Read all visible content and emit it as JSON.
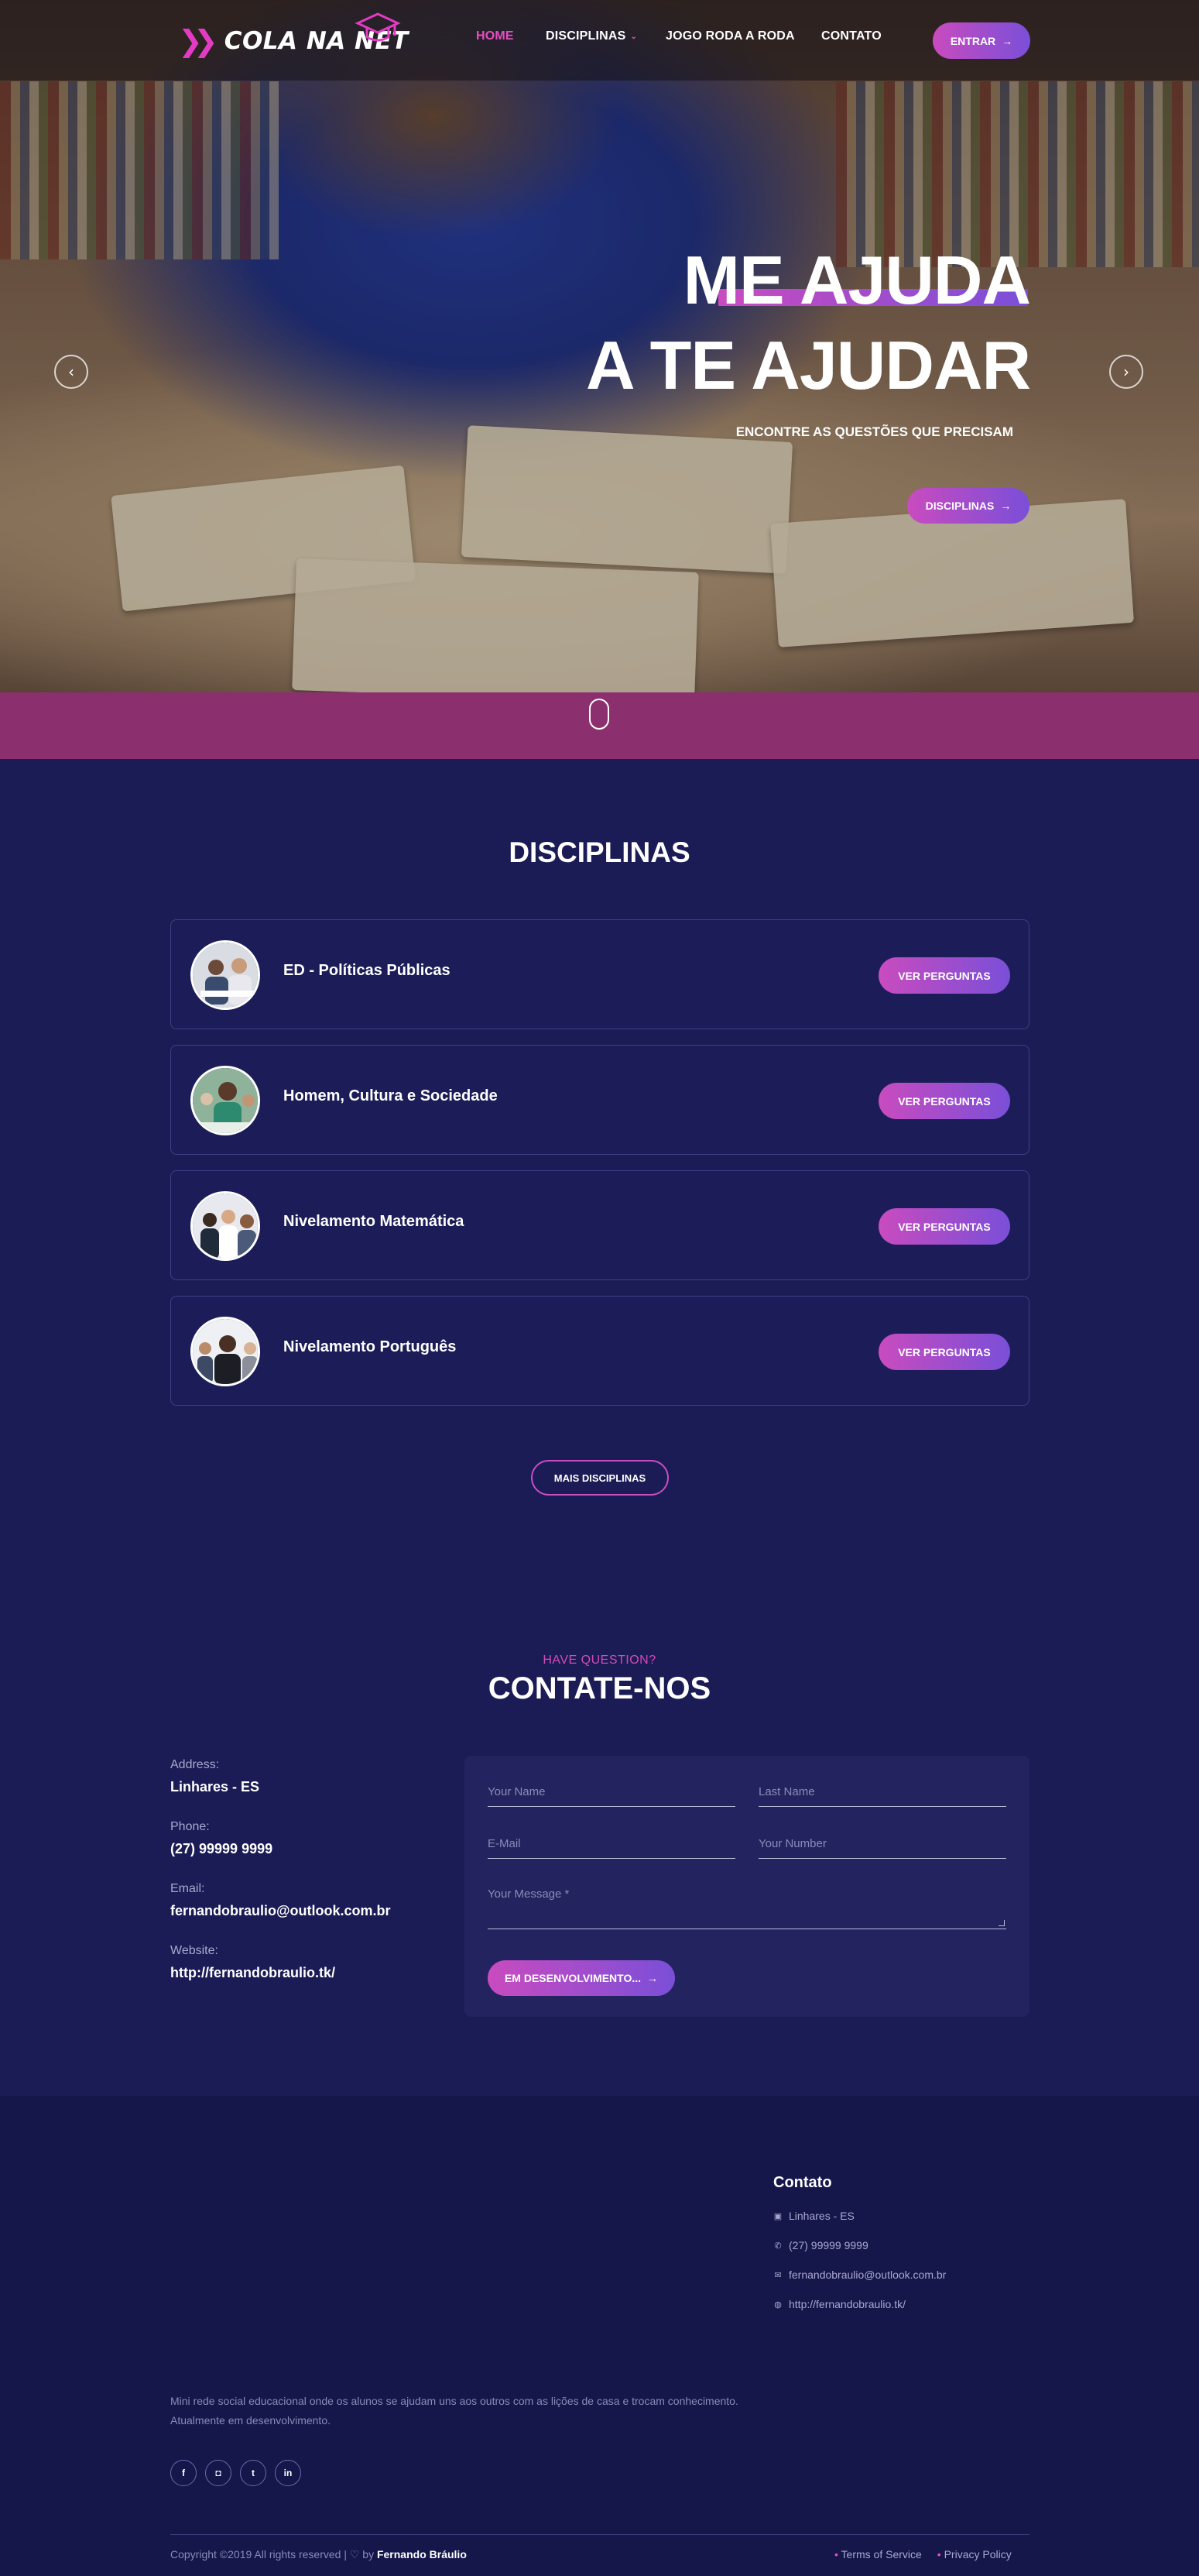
{
  "brand": {
    "name": "COLA NA NET",
    "accent": "#e23cc2",
    "gradient_start": "#c94bbf",
    "gradient_end": "#7a4fd8"
  },
  "nav": {
    "items": [
      {
        "label": "HOME",
        "active": true
      },
      {
        "label": "DISCIPLINAS",
        "active": false,
        "has_dropdown": true
      },
      {
        "label": "JOGO RODA A RODA",
        "active": false
      },
      {
        "label": "CONTATO",
        "active": false
      }
    ],
    "enter_button": "ENTRAR"
  },
  "hero": {
    "title_line1": "ME AJUDA",
    "title_line2": "A TE AJUDAR",
    "subtitle": "ENCONTRE AS QUESTÕES QUE PRECISAM",
    "button": "DISCIPLINAS"
  },
  "disciplinas": {
    "title": "DISCIPLINAS",
    "items": [
      {
        "name": "ED - Políticas Públicas",
        "button": "VER PERGUNTAS"
      },
      {
        "name": "Homem, Cultura e Sociedade",
        "button": "VER PERGUNTAS"
      },
      {
        "name": "Nivelamento Matemática",
        "button": "VER PERGUNTAS"
      },
      {
        "name": "Nivelamento Português",
        "button": "VER PERGUNTAS"
      }
    ],
    "more_button": "MAIS DISCIPLINAS"
  },
  "contact": {
    "eyebrow": "HAVE QUESTION?",
    "title": "CONTATE-NOS",
    "address_label": "Address:",
    "address_value": "Linhares - ES",
    "phone_label": "Phone:",
    "phone_value": "(27) 99999 9999",
    "email_label": "Email:",
    "email_value": "fernandobraulio@outlook.com.br",
    "website_label": "Website:",
    "website_value": "http://fernandobraulio.tk/",
    "form": {
      "first_name_placeholder": "Your Name",
      "last_name_placeholder": "Last Name",
      "email_placeholder": "E-Mail",
      "number_placeholder": "Your Number",
      "message_placeholder": "Your Message *",
      "submit": "EM DESENVOLVIMENTO..."
    }
  },
  "footer": {
    "heading": "Contato",
    "items": [
      {
        "icon": "map-icon",
        "text": "Linhares - ES"
      },
      {
        "icon": "phone-icon",
        "text": "(27) 99999 9999"
      },
      {
        "icon": "mail-icon",
        "text": "fernandobraulio@outlook.com.br"
      },
      {
        "icon": "globe-icon",
        "text": "http://fernandobraulio.tk/"
      }
    ],
    "description_line1": "Mini rede social educacional onde os alunos se ajudam uns aos outros com as lições de casa e trocam conhecimento.",
    "description_line2": "Atualmente em desenvolvimento.",
    "social": [
      {
        "icon": "facebook-icon",
        "glyph": "f"
      },
      {
        "icon": "instagram-icon",
        "glyph": "◘"
      },
      {
        "icon": "twitter-icon",
        "glyph": "t"
      },
      {
        "icon": "linkedin-icon",
        "glyph": "in"
      }
    ],
    "copyright_prefix": "Copyright ©2019 All rights reserved | ♡ by",
    "copyright_author": "Fernando Bráulio",
    "links": [
      "Terms of Service",
      "Privacy Policy"
    ]
  }
}
